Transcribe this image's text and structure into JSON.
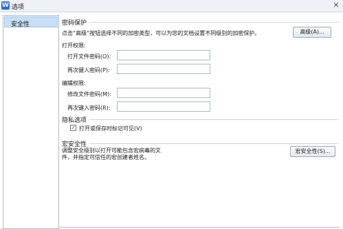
{
  "window": {
    "app_icon": "W",
    "title": "选项",
    "close_glyph": "✕"
  },
  "sidebar": {
    "items": [
      {
        "label": "安全性",
        "selected": true
      }
    ]
  },
  "password_protection": {
    "heading": "密码保护",
    "description": "点击“高级”按钮选择不同的加密类型，可以为您的文档设置不同级别的加密保护。",
    "advanced_button": "高级(A)..."
  },
  "open_permission": {
    "heading": "打开权限:",
    "password_label": "打开文件密码(O):",
    "password_value": "",
    "confirm_label": "再次键入密码(P):",
    "confirm_value": ""
  },
  "edit_permission": {
    "heading": "编辑权限:",
    "password_label": "修改文件密码(M):",
    "password_value": "",
    "confirm_label": "再次键入密码(R):",
    "confirm_value": ""
  },
  "privacy": {
    "heading": "隐私选项",
    "checkbox_label": "打开或保存时标记可见(V)",
    "checked": true,
    "check_glyph": "✓"
  },
  "macro_security": {
    "heading": "宏安全性",
    "description_line1": "调整安全级别以打开可能包含宏病毒的文",
    "description_line2": "件，并指定可信任的宏创建者姓名。",
    "button": "宏安全性(S)..."
  }
}
